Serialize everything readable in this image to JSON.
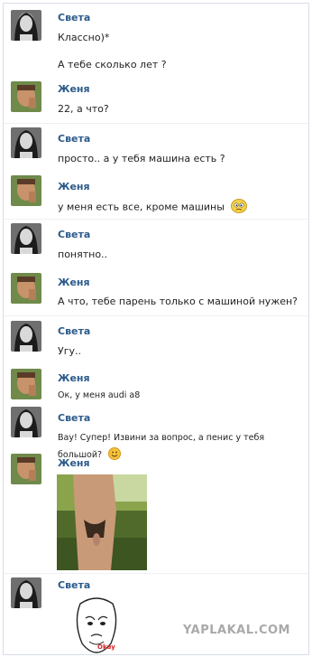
{
  "watermark": "YAPLAKAL.COM",
  "messages": [
    {
      "sender": "Света",
      "lines": [
        "Классно)*",
        "А тебе сколько лет ?"
      ]
    },
    {
      "sender": "Женя",
      "lines": [
        "22, а что?"
      ]
    },
    {
      "sender": "Света",
      "lines": [
        "просто.. а у тебя машина есть ?"
      ]
    },
    {
      "sender": "Женя",
      "lines": [
        "у меня есть все, кроме машины"
      ]
    },
    {
      "sender": "Света",
      "lines": [
        "понятно.."
      ]
    },
    {
      "sender": "Женя",
      "lines": [
        "А что, тебе парень только с машиной нужен?"
      ]
    },
    {
      "sender": "Света",
      "lines": [
        "Угу.."
      ]
    },
    {
      "sender": "Женя",
      "lines": [
        "Ок, у меня audi a8"
      ]
    },
    {
      "sender": "Света",
      "lines": [
        "Вау! Супер! Извини за вопрос, а пенис у тебя",
        "большой?"
      ]
    },
    {
      "sender": "Женя",
      "lines": []
    },
    {
      "sender": "Света",
      "lines": []
    }
  ],
  "meme_caption": "Okay",
  "icons": {
    "confused": "confused-emoji-icon",
    "smile": "smile-emoji-icon"
  }
}
